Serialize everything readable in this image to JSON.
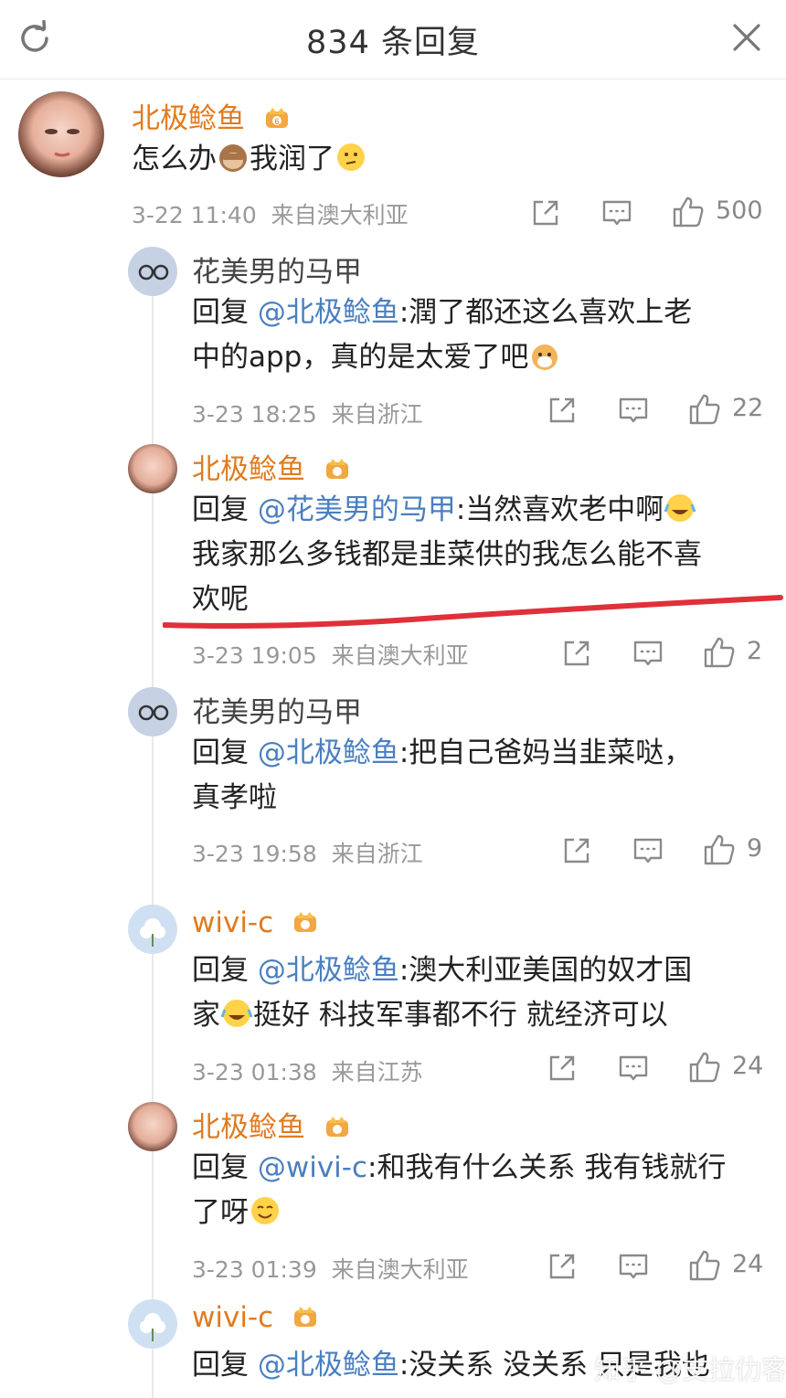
{
  "header": {
    "title": "834 条回复"
  },
  "main_comment": {
    "user": "北极鲶鱼",
    "text_before": "怎么办",
    "text_middle": "我润了",
    "emoji_1": "monkey-see-no-evil-emoji",
    "emoji_2": "thinking-face-emoji",
    "time": "3-22 11:40",
    "location": "来自澳大利亚",
    "likes": "500"
  },
  "replies": [
    {
      "user": "花美男的马甲",
      "reply_label": "回复 ",
      "mention": "@北极鲶鱼",
      "text_line1": ":潤了都还这么喜欢上老",
      "text_line2": "中的app，真的是太爱了吧",
      "emoji": "dog-face-emoji",
      "time": "3-23 18:25",
      "location": "来自浙江",
      "likes": "22"
    },
    {
      "user": "北极鲶鱼",
      "reply_label": "回复 ",
      "mention": "@花美男的马甲",
      "text_line1": ":当然喜欢老中啊",
      "text_line2": "我家那么多钱都是韭菜供的我怎么能不喜",
      "text_line3": "欢呢",
      "emoji": "laughing-crying-emoji",
      "time": "3-23 19:05",
      "location": "来自澳大利亚",
      "likes": "2"
    },
    {
      "user": "花美男的马甲",
      "reply_label": "回复 ",
      "mention": "@北极鲶鱼",
      "text_line1": ":把自己爸妈当韭菜哒，",
      "text_line2": "真孝啦",
      "time": "3-23 19:58",
      "location": "来自浙江",
      "likes": "9"
    },
    {
      "user": "wivi-c",
      "reply_label": "回复 ",
      "mention": "@北极鲶鱼",
      "text_line1": ":澳大利亚美国的奴才国",
      "text_line2a": "家",
      "text_line2b": "挺好 科技军事都不行 就经济可以",
      "emoji": "laughing-crying-emoji",
      "time": "3-23 01:38",
      "location": "来自江苏",
      "likes": "24"
    },
    {
      "user": "北极鲶鱼",
      "reply_label": "回复 ",
      "mention": "@wivi-c",
      "text_line1": ":和我有什么关系 我有钱就行",
      "text_line2": "了呀",
      "emoji": "smiling-face-emoji",
      "time": "3-23 01:39",
      "location": "来自澳大利亚",
      "likes": "24"
    },
    {
      "user": "wivi-c",
      "reply_label": "回复 ",
      "mention": "@北极鲶鱼",
      "text_line1": ":没关系 没关系 只是我也"
    }
  ],
  "watermark": "知乎 @支拉仂客",
  "colors": {
    "username": "#e07b1f",
    "mention": "#4a7fc0",
    "meta": "#999999",
    "annotation_line": "#e0303a"
  }
}
